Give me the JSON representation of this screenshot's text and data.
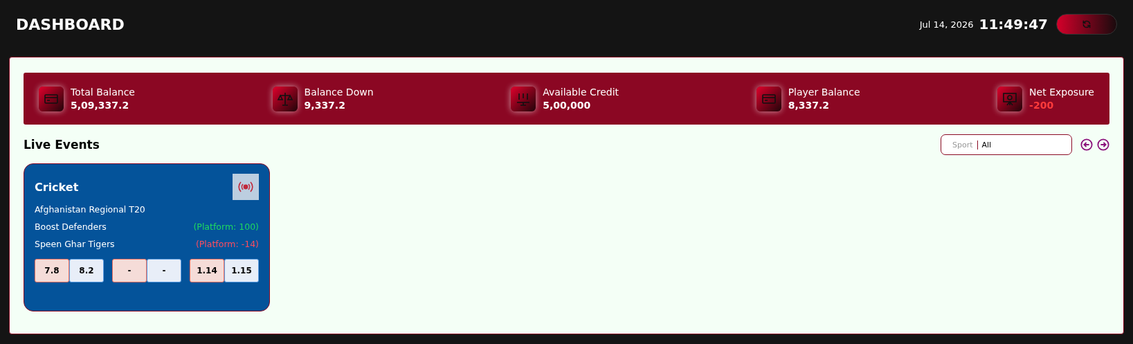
{
  "header": {
    "title": "DASHBOARD",
    "date": "Jul 14, 2026",
    "time": "11:49:47"
  },
  "stats": [
    {
      "label": "Total Balance",
      "value": "5,09,337.2",
      "kind": "card",
      "negative": false
    },
    {
      "label": "Balance Down",
      "value": "9,337.2",
      "kind": "scales",
      "negative": false
    },
    {
      "label": "Available Credit",
      "value": "5,00,000",
      "kind": "chart",
      "negative": false
    },
    {
      "label": "Player Balance",
      "value": "8,337.2",
      "kind": "card",
      "negative": false
    },
    {
      "label": "Net Exposure",
      "value": "-200",
      "kind": "board",
      "negative": true
    }
  ],
  "live_events": {
    "title": "Live Events",
    "filter": {
      "label": "Sport",
      "value": "All"
    },
    "events": [
      {
        "sport": "Cricket",
        "competition": "Afghanistan Regional T20",
        "teams": [
          {
            "name": "Boost Defenders",
            "platform": "(Platform: 100)",
            "negative": false
          },
          {
            "name": "Speen Ghar Tigers",
            "platform": "(Platform: -14)",
            "negative": true
          }
        ],
        "odds": [
          {
            "back": "7.8",
            "lay": "8.2"
          },
          {
            "back": "-",
            "lay": "-"
          },
          {
            "back": "1.14",
            "lay": "1.15"
          }
        ]
      }
    ]
  }
}
